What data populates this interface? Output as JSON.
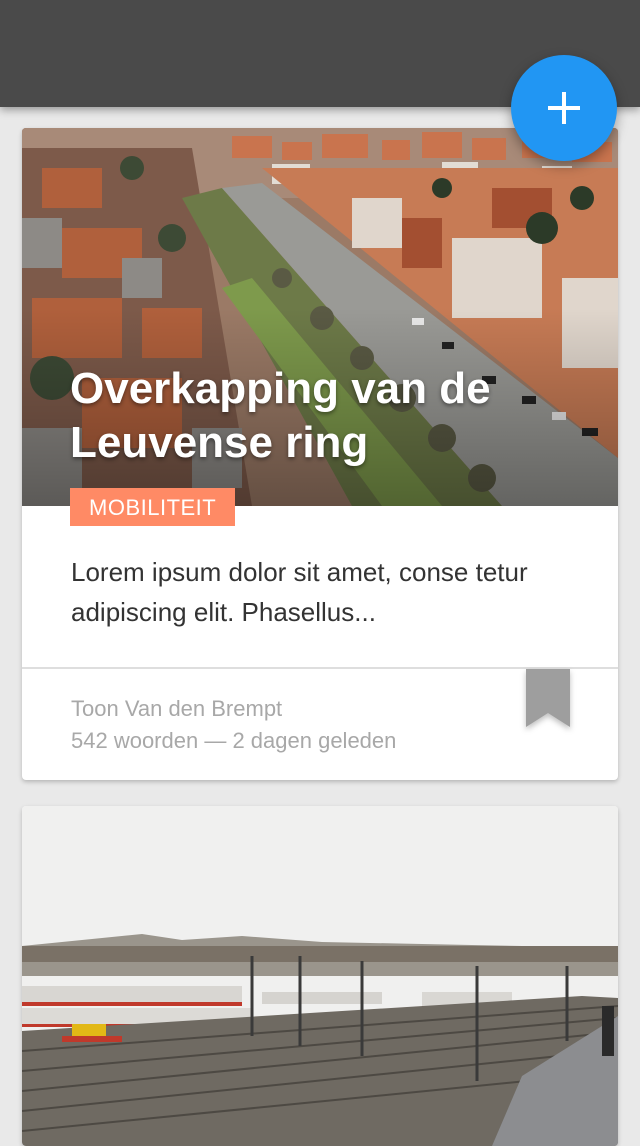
{
  "app_bar": {
    "fab_label": "add-new"
  },
  "cards": [
    {
      "title": "Overkapping van de Leuvense ring",
      "category": "MOBILITEIT",
      "excerpt": "Lorem ipsum dolor sit amet, conse tetur adipiscing elit. Phasellus...",
      "author": "Toon Van den Brempt",
      "word_count": "542 woorden",
      "separator": " — ",
      "posted": "2 dagen geleden"
    },
    {
      "image": "train-yard-photo"
    }
  ],
  "colors": {
    "app_bar": "#4a4a4a",
    "fab": "#2196f3",
    "category_tag": "#ff8a65",
    "bookmark": "#9e9e9e"
  },
  "icons": {
    "fab": "plus-icon",
    "card_action": "bookmark-icon"
  }
}
